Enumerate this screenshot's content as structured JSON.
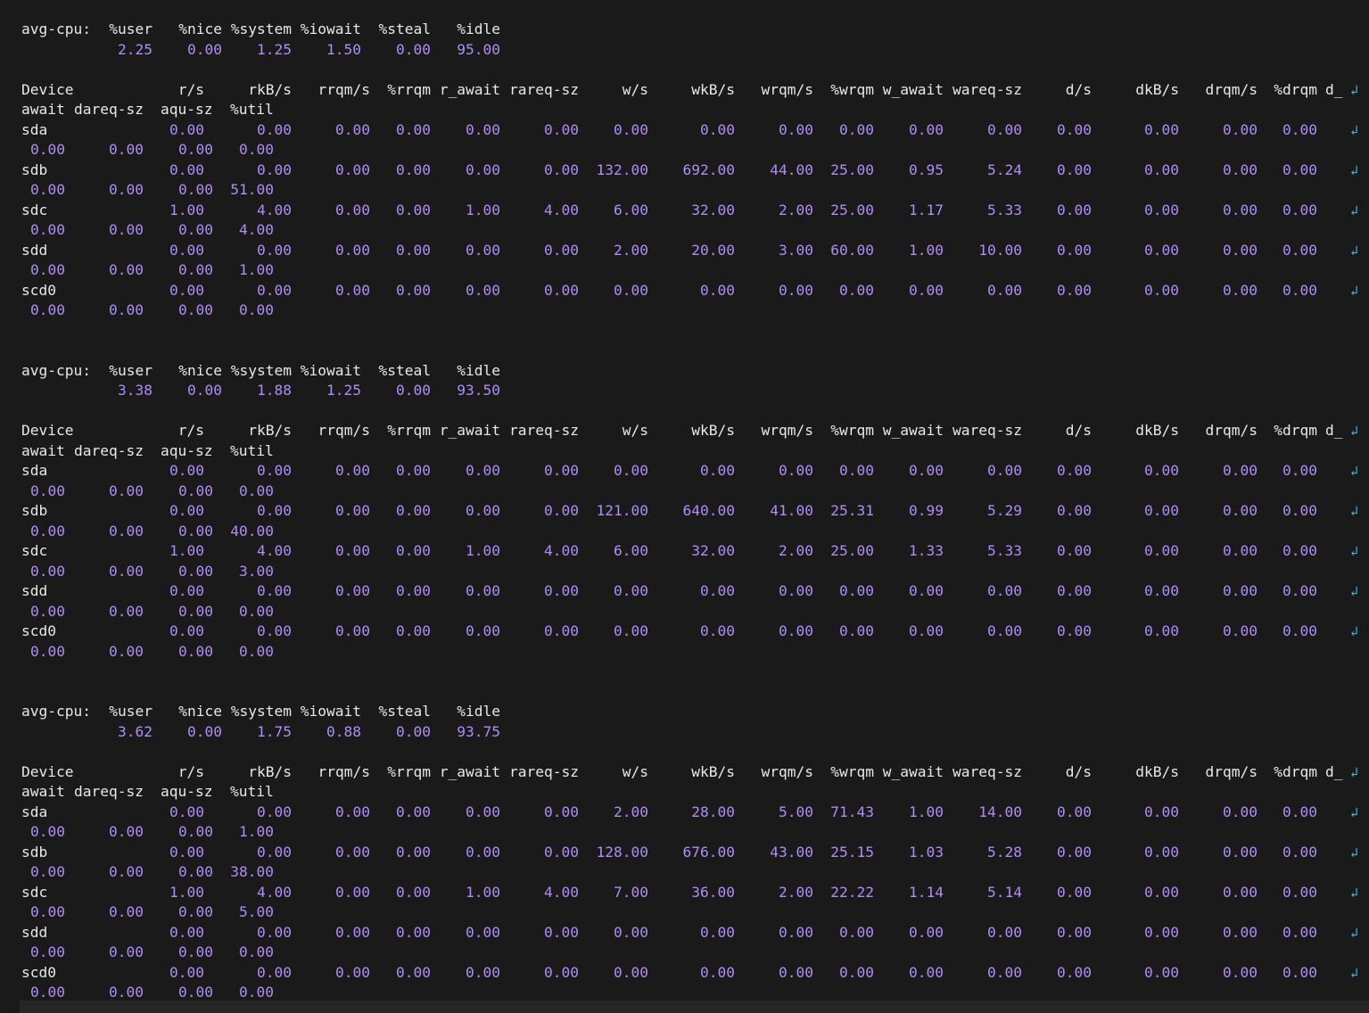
{
  "terminal": {
    "colors": {
      "background": "#1a1a1a",
      "header_text": "#e8e8e8",
      "number_text": "#b18cf7",
      "wrap_marker": "#3fb7d8"
    },
    "wrap_marker_icon": "wrap-arrow-icon",
    "wrap_marker_glyph": "↲"
  },
  "cpu_header": [
    "avg-cpu:",
    "%user",
    "%nice",
    "%system",
    "%iowait",
    "%steal",
    "%idle"
  ],
  "device_header": {
    "line1": [
      "Device",
      "r/s",
      "rkB/s",
      "rrqm/s",
      "%rrqm",
      "r_await",
      "rareq-sz",
      "w/s",
      "wkB/s",
      "wrqm/s",
      "%wrqm",
      "w_await",
      "wareq-sz",
      "d/s",
      "dkB/s",
      "drqm/s",
      "%drqm",
      "d_"
    ],
    "line2": [
      "await",
      "dareq-sz",
      "aqu-sz",
      "%util"
    ]
  },
  "samples": [
    {
      "cpu": [
        "2.25",
        "0.00",
        "1.25",
        "1.50",
        "0.00",
        "95.00"
      ],
      "devices": [
        {
          "name": "sda",
          "line1": [
            "0.00",
            "0.00",
            "0.00",
            "0.00",
            "0.00",
            "0.00",
            "0.00",
            "0.00",
            "0.00",
            "0.00",
            "0.00",
            "0.00",
            "0.00",
            "0.00",
            "0.00",
            "0.00"
          ],
          "line2": [
            "0.00",
            "0.00",
            "0.00",
            "0.00"
          ]
        },
        {
          "name": "sdb",
          "line1": [
            "0.00",
            "0.00",
            "0.00",
            "0.00",
            "0.00",
            "0.00",
            "132.00",
            "692.00",
            "44.00",
            "25.00",
            "0.95",
            "5.24",
            "0.00",
            "0.00",
            "0.00",
            "0.00"
          ],
          "line2": [
            "0.00",
            "0.00",
            "0.00",
            "51.00"
          ]
        },
        {
          "name": "sdc",
          "line1": [
            "1.00",
            "4.00",
            "0.00",
            "0.00",
            "1.00",
            "4.00",
            "6.00",
            "32.00",
            "2.00",
            "25.00",
            "1.17",
            "5.33",
            "0.00",
            "0.00",
            "0.00",
            "0.00"
          ],
          "line2": [
            "0.00",
            "0.00",
            "0.00",
            "4.00"
          ]
        },
        {
          "name": "sdd",
          "line1": [
            "0.00",
            "0.00",
            "0.00",
            "0.00",
            "0.00",
            "0.00",
            "2.00",
            "20.00",
            "3.00",
            "60.00",
            "1.00",
            "10.00",
            "0.00",
            "0.00",
            "0.00",
            "0.00"
          ],
          "line2": [
            "0.00",
            "0.00",
            "0.00",
            "1.00"
          ]
        },
        {
          "name": "scd0",
          "line1": [
            "0.00",
            "0.00",
            "0.00",
            "0.00",
            "0.00",
            "0.00",
            "0.00",
            "0.00",
            "0.00",
            "0.00",
            "0.00",
            "0.00",
            "0.00",
            "0.00",
            "0.00",
            "0.00"
          ],
          "line2": [
            "0.00",
            "0.00",
            "0.00",
            "0.00"
          ]
        }
      ]
    },
    {
      "cpu": [
        "3.38",
        "0.00",
        "1.88",
        "1.25",
        "0.00",
        "93.50"
      ],
      "devices": [
        {
          "name": "sda",
          "line1": [
            "0.00",
            "0.00",
            "0.00",
            "0.00",
            "0.00",
            "0.00",
            "0.00",
            "0.00",
            "0.00",
            "0.00",
            "0.00",
            "0.00",
            "0.00",
            "0.00",
            "0.00",
            "0.00"
          ],
          "line2": [
            "0.00",
            "0.00",
            "0.00",
            "0.00"
          ]
        },
        {
          "name": "sdb",
          "line1": [
            "0.00",
            "0.00",
            "0.00",
            "0.00",
            "0.00",
            "0.00",
            "121.00",
            "640.00",
            "41.00",
            "25.31",
            "0.99",
            "5.29",
            "0.00",
            "0.00",
            "0.00",
            "0.00"
          ],
          "line2": [
            "0.00",
            "0.00",
            "0.00",
            "40.00"
          ]
        },
        {
          "name": "sdc",
          "line1": [
            "1.00",
            "4.00",
            "0.00",
            "0.00",
            "1.00",
            "4.00",
            "6.00",
            "32.00",
            "2.00",
            "25.00",
            "1.33",
            "5.33",
            "0.00",
            "0.00",
            "0.00",
            "0.00"
          ],
          "line2": [
            "0.00",
            "0.00",
            "0.00",
            "3.00"
          ]
        },
        {
          "name": "sdd",
          "line1": [
            "0.00",
            "0.00",
            "0.00",
            "0.00",
            "0.00",
            "0.00",
            "0.00",
            "0.00",
            "0.00",
            "0.00",
            "0.00",
            "0.00",
            "0.00",
            "0.00",
            "0.00",
            "0.00"
          ],
          "line2": [
            "0.00",
            "0.00",
            "0.00",
            "0.00"
          ]
        },
        {
          "name": "scd0",
          "line1": [
            "0.00",
            "0.00",
            "0.00",
            "0.00",
            "0.00",
            "0.00",
            "0.00",
            "0.00",
            "0.00",
            "0.00",
            "0.00",
            "0.00",
            "0.00",
            "0.00",
            "0.00",
            "0.00"
          ],
          "line2": [
            "0.00",
            "0.00",
            "0.00",
            "0.00"
          ]
        }
      ]
    },
    {
      "cpu": [
        "3.62",
        "0.00",
        "1.75",
        "0.88",
        "0.00",
        "93.75"
      ],
      "devices": [
        {
          "name": "sda",
          "line1": [
            "0.00",
            "0.00",
            "0.00",
            "0.00",
            "0.00",
            "0.00",
            "2.00",
            "28.00",
            "5.00",
            "71.43",
            "1.00",
            "14.00",
            "0.00",
            "0.00",
            "0.00",
            "0.00"
          ],
          "line2": [
            "0.00",
            "0.00",
            "0.00",
            "1.00"
          ]
        },
        {
          "name": "sdb",
          "line1": [
            "0.00",
            "0.00",
            "0.00",
            "0.00",
            "0.00",
            "0.00",
            "128.00",
            "676.00",
            "43.00",
            "25.15",
            "1.03",
            "5.28",
            "0.00",
            "0.00",
            "0.00",
            "0.00"
          ],
          "line2": [
            "0.00",
            "0.00",
            "0.00",
            "38.00"
          ]
        },
        {
          "name": "sdc",
          "line1": [
            "1.00",
            "4.00",
            "0.00",
            "0.00",
            "1.00",
            "4.00",
            "7.00",
            "36.00",
            "2.00",
            "22.22",
            "1.14",
            "5.14",
            "0.00",
            "0.00",
            "0.00",
            "0.00"
          ],
          "line2": [
            "0.00",
            "0.00",
            "0.00",
            "5.00"
          ]
        },
        {
          "name": "sdd",
          "line1": [
            "0.00",
            "0.00",
            "0.00",
            "0.00",
            "0.00",
            "0.00",
            "0.00",
            "0.00",
            "0.00",
            "0.00",
            "0.00",
            "0.00",
            "0.00",
            "0.00",
            "0.00",
            "0.00"
          ],
          "line2": [
            "0.00",
            "0.00",
            "0.00",
            "0.00"
          ]
        },
        {
          "name": "scd0",
          "line1": [
            "0.00",
            "0.00",
            "0.00",
            "0.00",
            "0.00",
            "0.00",
            "0.00",
            "0.00",
            "0.00",
            "0.00",
            "0.00",
            "0.00",
            "0.00",
            "0.00",
            "0.00",
            "0.00"
          ],
          "line2": [
            "0.00",
            "0.00",
            "0.00",
            "0.00"
          ]
        }
      ]
    }
  ]
}
